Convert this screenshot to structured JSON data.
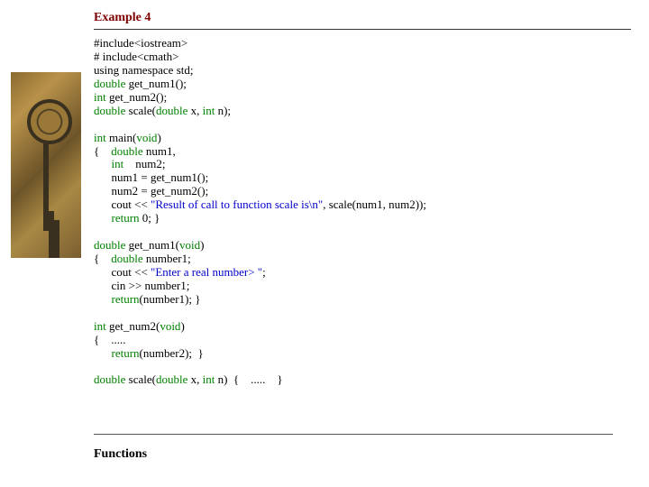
{
  "title": "Example 4",
  "code": {
    "l1": "#include<iostream>",
    "l2": "# include<cmath>",
    "l3": "using namespace std;",
    "l4a": "double",
    "l4b": " get_num1();",
    "l5a": "int",
    "l5b": " get_num2();",
    "l6a": "double",
    "l6b": " scale(",
    "l6c": "double",
    "l6d": " x, ",
    "l6e": "int",
    "l6f": " n);",
    "l7a": "int",
    "l7b": " main(",
    "l7c": "void",
    "l7d": ")",
    "l8a": "{    ",
    "l8b": "double",
    "l8c": " num1,",
    "l9a": "      ",
    "l9b": "int",
    "l9c": "    num2;",
    "l10": "      num1 = get_num1();",
    "l11": "      num2 = get_num2();",
    "l12a": "      cout << ",
    "l12b": "\"Result of call to function scale is\\n\"",
    "l12c": ", scale(num1, num2));",
    "l13a": "      ",
    "l13b": "return",
    "l13c": " 0; }",
    "l14a": "double",
    "l14b": " get_num1(",
    "l14c": "void",
    "l14d": ")",
    "l15a": "{    ",
    "l15b": "double",
    "l15c": " number1;",
    "l16a": "      cout << ",
    "l16b": "\"Enter a real number> \"",
    "l16c": ";",
    "l17": "      cin >> number1;",
    "l18a": "      ",
    "l18b": "return",
    "l18c": "(number1); }",
    "l19a": "int",
    "l19b": " get_num2(",
    "l19c": "void",
    "l19d": ")",
    "l20": "{    .....",
    "l21a": "      ",
    "l21b": "return",
    "l21c": "(number2);  }",
    "l22a": "double",
    "l22b": " scale(",
    "l22c": "double",
    "l22d": " x, ",
    "l22e": "int",
    "l22f": " n)  {    .....    }"
  },
  "footer": "Functions"
}
